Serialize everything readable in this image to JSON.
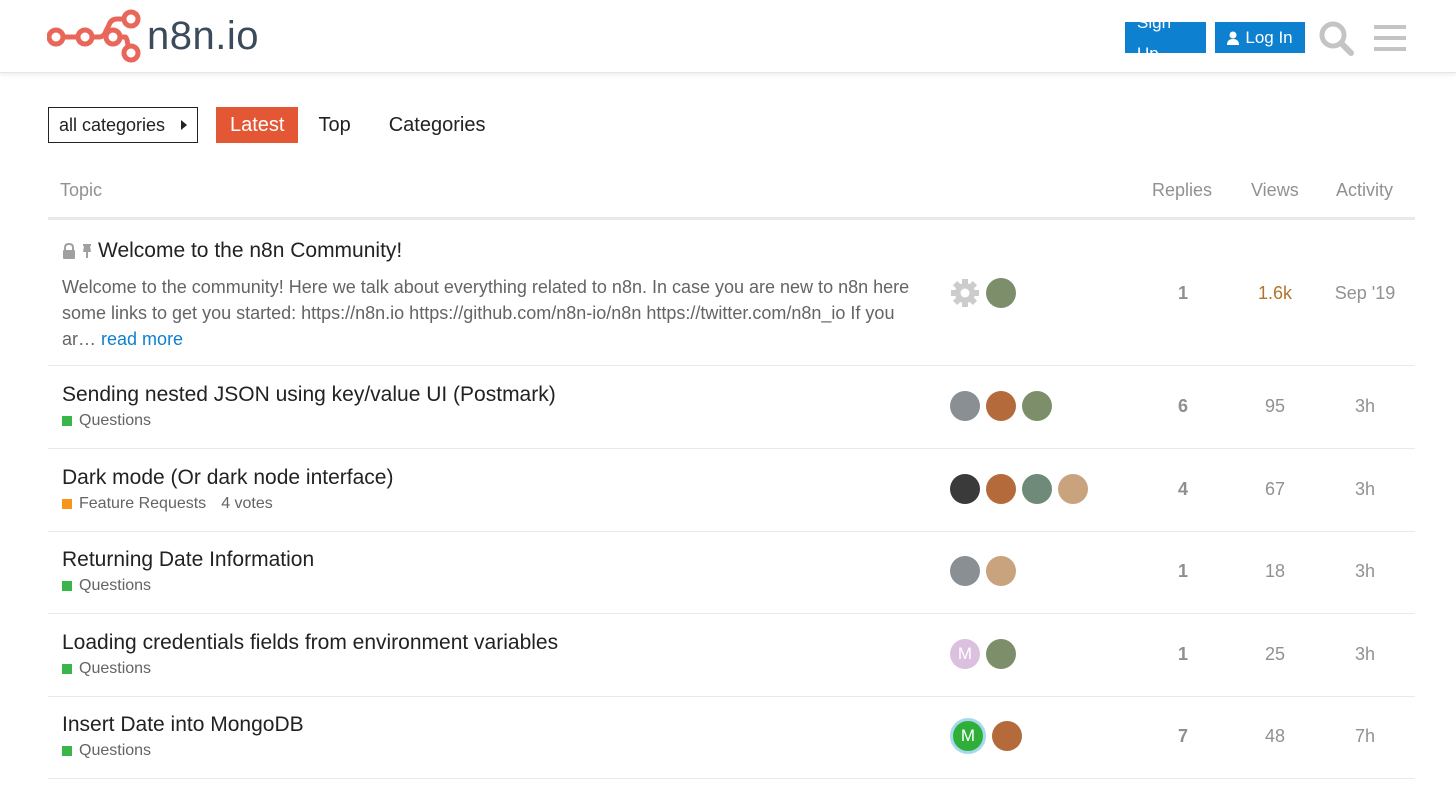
{
  "header": {
    "logo_text": "n8n.io",
    "signup_label": "Sign Up",
    "login_label": "Log In",
    "accent": "#0e80d0"
  },
  "nav": {
    "category_dropdown": "all categories",
    "tabs": [
      "Latest",
      "Top",
      "Categories"
    ],
    "active_tab": "Latest",
    "active_color": "#e45735"
  },
  "columns": {
    "topic": "Topic",
    "replies": "Replies",
    "views": "Views",
    "activity": "Activity"
  },
  "topics": [
    {
      "title": "Welcome to the n8n Community!",
      "pinned": true,
      "locked": true,
      "excerpt": "Welcome to the community! Here we talk about everything related to n8n. In case you are new to n8n here some links to get you started: https://n8n.io https://github.com/n8n-io/n8n https://twitter.com/n8n_io If you ar…",
      "read_more": "read more",
      "replies": "1",
      "views": "1.6k",
      "activity": "Sep '19"
    },
    {
      "title": "Sending nested JSON using key/value UI (Postmark)",
      "category": "Questions",
      "category_color": "#3ab54a",
      "replies": "6",
      "views": "95",
      "activity": "3h"
    },
    {
      "title": "Dark mode (Or dark node interface)",
      "category": "Feature Requests",
      "category_color": "#f7941d",
      "votes": "4 votes",
      "replies": "4",
      "views": "67",
      "activity": "3h"
    },
    {
      "title": "Returning Date Information",
      "category": "Questions",
      "category_color": "#3ab54a",
      "replies": "1",
      "views": "18",
      "activity": "3h"
    },
    {
      "title": "Loading credentials fields from environment variables",
      "category": "Questions",
      "category_color": "#3ab54a",
      "replies": "1",
      "views": "25",
      "activity": "3h"
    },
    {
      "title": "Insert Date into MongoDB",
      "category": "Questions",
      "category_color": "#3ab54a",
      "replies": "7",
      "views": "48",
      "activity": "7h"
    }
  ],
  "avatar_letters": {
    "m_light": "M",
    "m_green": "M"
  }
}
